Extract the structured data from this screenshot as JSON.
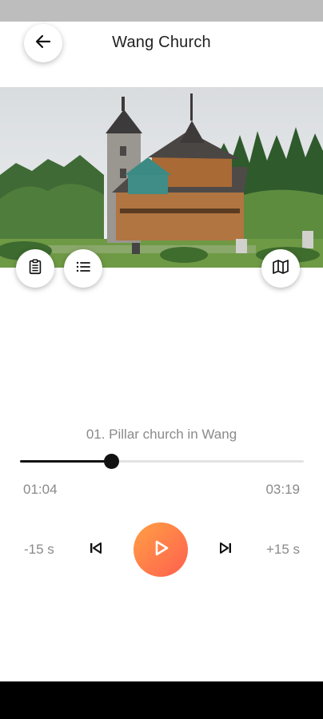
{
  "header": {
    "title": "Wang Church",
    "back_icon": "arrow-left-icon"
  },
  "image": {
    "description_icon": "photo-of-stave-church"
  },
  "actions": {
    "notes_icon": "clipboard-icon",
    "list_icon": "list-icon",
    "map_icon": "map-icon"
  },
  "player": {
    "track_title": "01. Pillar church in Wang",
    "elapsed": "01:04",
    "total": "03:19",
    "progress_fraction": 0.321,
    "skip_back_label": "-15 s",
    "skip_forward_label": "+15 s",
    "accent_gradient": [
      "#ffa044",
      "#ff5f4f"
    ]
  }
}
